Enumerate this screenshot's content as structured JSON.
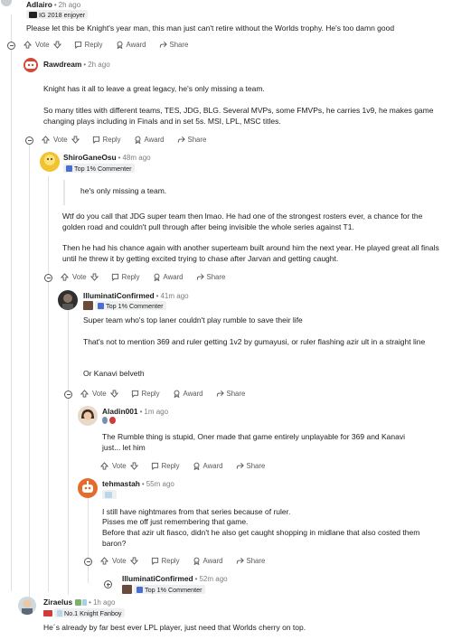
{
  "common": {
    "vote": "Vote",
    "reply": "Reply",
    "award": "Award",
    "share": "Share"
  },
  "c1": {
    "author": "Adlairo",
    "time": "2h ago",
    "flair": "IG 2018 enjoyer",
    "body": "Please let this be Knight's year man, this man just can't retire without the Worlds trophy. He's too damn good"
  },
  "c2": {
    "author": "Rawdream",
    "time": "2h ago",
    "p1": "Knight has it all to leave a great legacy, he's only missing a team.",
    "p2": "So many titles with different teams, TES, JDG, BLG. Several MVPs, some FMVPs, he carries 1v9, he makes game changing plays including in Finals and in set 5s. MSI, LPL, MSC titles."
  },
  "c3": {
    "author": "ShiroGaneOsu",
    "time": "48m ago",
    "flair": "Top 1% Commenter",
    "quote": "he's only missing a team.",
    "p1": "Wtf do you call that JDG super team then lmao. He had one of the strongest rosters ever, a chance for the golden road and couldn't pull through after being invisible the whole series against T1.",
    "p2": "Then he had his chance again with another superteam built around him the next year. He played great all finals until he threw it by getting excited trying to chase after Jarvan and getting caught."
  },
  "c4": {
    "author": "IlluminatiConfirmed",
    "time": "41m ago",
    "flair": "Top 1% Commenter",
    "p1": "Super team who's top laner couldn't play rumble to save their life",
    "p2": "That's not to mention 369 and ruler getting 1v2 by gumayusi, or ruler flashing azir ult in a straight line",
    "p3": "Or Kanavi belveth"
  },
  "c5": {
    "author": "Aladin001",
    "time": "1m ago",
    "body": "The Rumble thing is stupid, Oner made that game entirely unplayable for 369 and Kanavi just... let him"
  },
  "c6": {
    "author": "tehmastah",
    "time": "55m ago",
    "l1": "I still have nightmares from that series because of ruler.",
    "l2": "Pisses me off just remembering that game.",
    "l3": "Before that azir ult fiasco, didn't he also get caught shopping in midlane that also costed them baron?"
  },
  "c7": {
    "author": "IlluminatiConfirmed",
    "time": "52m ago",
    "flair": "Top 1% Commenter"
  },
  "c8": {
    "author": "Ziraelus",
    "time": "1h ago",
    "flair": "No.1 Knight Fanboy",
    "body": "He´s already by far best ever LPL player, just need that Worlds cherry on top."
  },
  "colors": {
    "flair_bg": "#edeff1",
    "thread_line": "#e0e0e0",
    "meta": "#7c7c7c"
  }
}
